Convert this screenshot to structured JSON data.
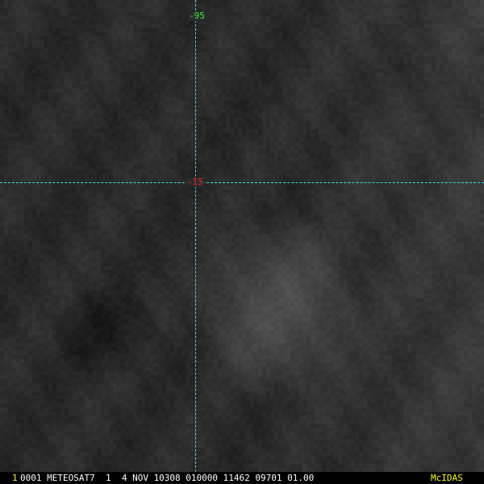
{
  "map": {
    "grid": {
      "longitude_label": "-95",
      "latitude_label": "-15",
      "line_color": "#30e0e0",
      "longitude_label_color": "#33ee33",
      "latitude_label_color": "#ee2222"
    }
  },
  "status_bar": {
    "frame_number": "1",
    "image_info": "0001 METEOSAT7  1  4 NOV 10308 010000 11462 09701 01.00",
    "software": "McIDAS",
    "highlight_color": "#ffff00",
    "text_color": "#ffffff"
  }
}
